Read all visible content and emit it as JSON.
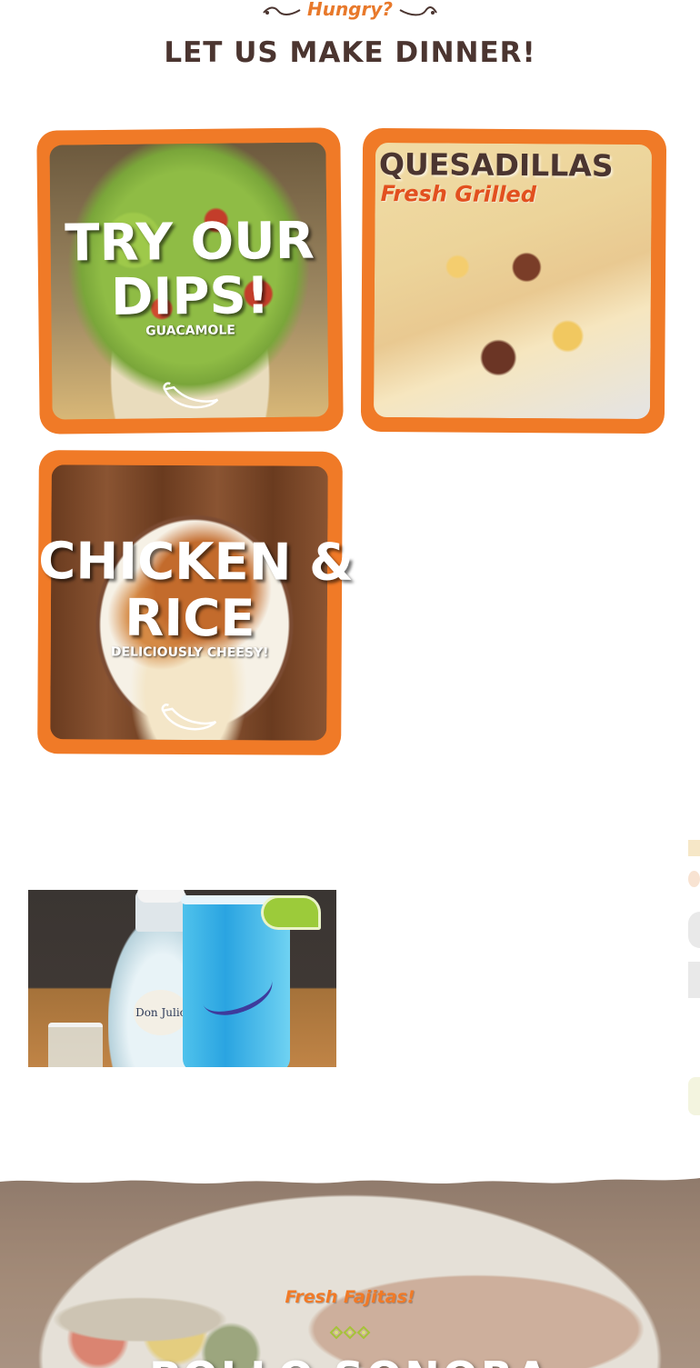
{
  "header": {
    "kicker": "Hungry?",
    "headline": "LET US MAKE DINNER!"
  },
  "cards": [
    {
      "title_line1": "TRY OUR",
      "title_line2": "DIPS!",
      "subtitle": "GUACAMOLE"
    },
    {
      "title": "QUESADILLAS",
      "subtitle": "Fresh Grilled"
    },
    {
      "title_line1": "CHICKEN &",
      "title_line2": "RICE",
      "subtitle": "DELICIOUSLY CHEESY!"
    }
  ],
  "drink": {
    "bottle_label": "Don Julio"
  },
  "fajitas": {
    "kicker": "Fresh Fajitas!",
    "title": "POLLO SONORA"
  },
  "colors": {
    "accent_orange": "#f07a27",
    "brown_text": "#4b3530",
    "red_subtitle": "#e2501f"
  },
  "icons": {
    "flourish": "flourish-icon",
    "pepper": "chili-pepper-icon",
    "diamonds": "diamond-ornament-icon"
  }
}
